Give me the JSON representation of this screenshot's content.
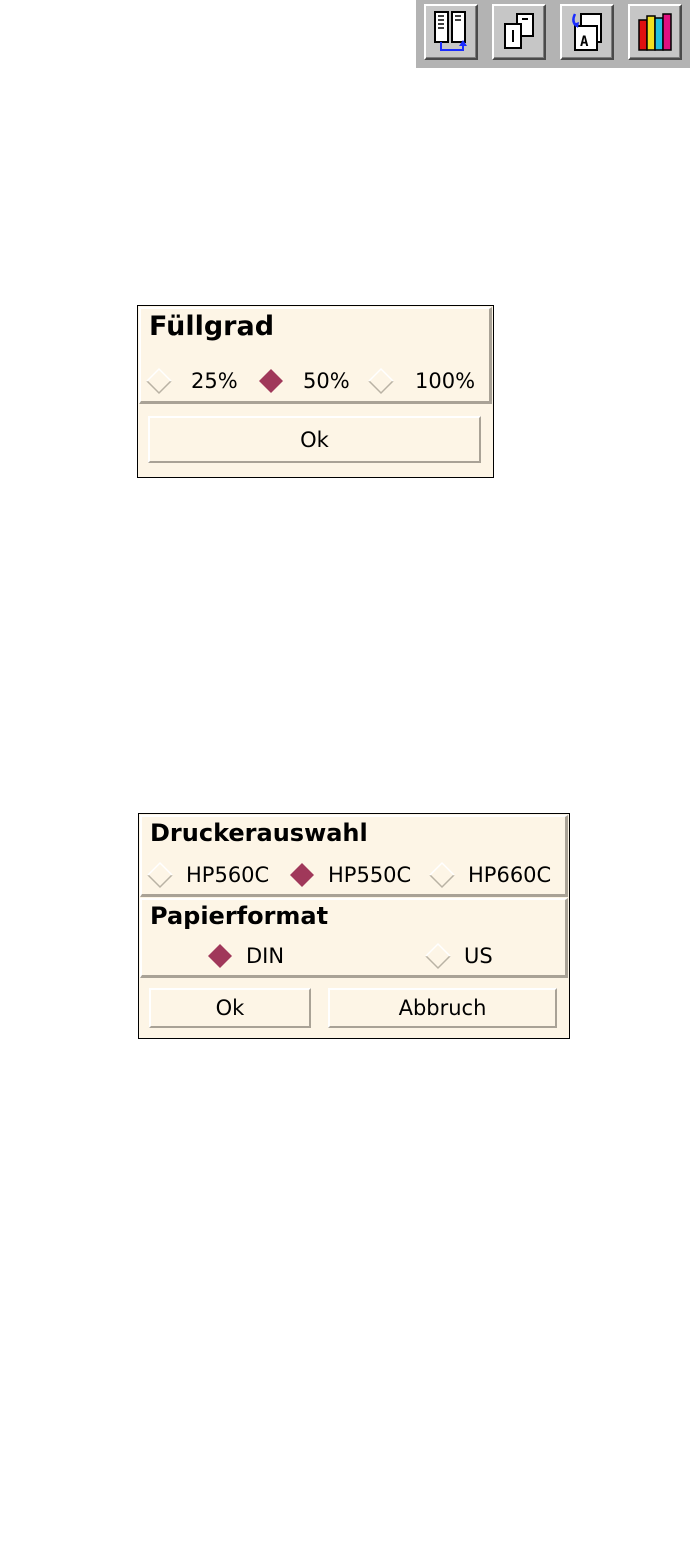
{
  "toolbar": {
    "buttons": [
      {
        "name": "layout-columns-icon"
      },
      {
        "name": "page-order-icon"
      },
      {
        "name": "text-rotate-icon"
      },
      {
        "name": "books-icon"
      }
    ]
  },
  "dialog_fill": {
    "title": "Füllgrad",
    "options": [
      "25%",
      "50%",
      "100%"
    ],
    "selected": "50%",
    "ok_label": "Ok"
  },
  "dialog_printer": {
    "printer": {
      "title": "Druckerauswahl",
      "options": [
        "HP560C",
        "HP550C",
        "HP660C"
      ],
      "selected": "HP550C"
    },
    "paper": {
      "title": "Papierformat",
      "options": [
        "DIN",
        "US"
      ],
      "selected": "DIN"
    },
    "ok_label": "Ok",
    "cancel_label": "Abbruch"
  },
  "colors": {
    "dialog_bg": "#fdf5e6",
    "selected_diamond": "#a0385a",
    "toolbar_bg": "#b3b3b3"
  }
}
